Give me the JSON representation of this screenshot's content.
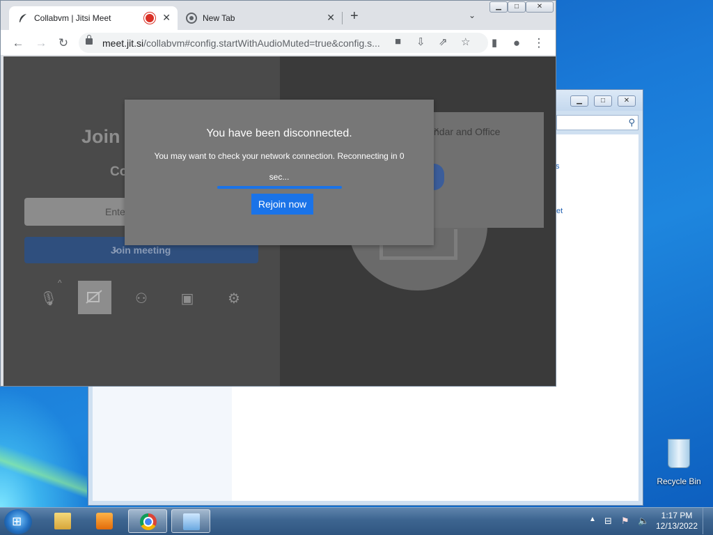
{
  "browser": {
    "tabs": [
      {
        "title": "Collabvm | Jitsi Meet",
        "active": true,
        "recording": true
      },
      {
        "title": "New Tab",
        "active": false
      }
    ],
    "new_tab_label": "+",
    "address": {
      "url_host": "meet.jit.si",
      "url_rest": "/collabvm#config.startWithAudioMuted=true&config.s..."
    }
  },
  "page": {
    "join_heading": "Join",
    "room_heading": "Co",
    "name_placeholder": "Ente",
    "join_button": "Join meeting",
    "calendar_text": "ndar and Office",
    "calendar_close": "×"
  },
  "modal": {
    "title": "You have been disconnected.",
    "message": "You may want to check your network connection. Reconnecting in 0 sec...",
    "rejoin_button": "Rejoin now",
    "progress": 1.0
  },
  "background_window": {
    "link1": "s",
    "link2": "et"
  },
  "desktop": {
    "recycle_bin_label": "Recycle Bin"
  },
  "taskbar": {
    "time": "1:17 PM",
    "date": "12/13/2022"
  },
  "colors": {
    "accent": "#1a73e8",
    "recording": "#d93025"
  }
}
